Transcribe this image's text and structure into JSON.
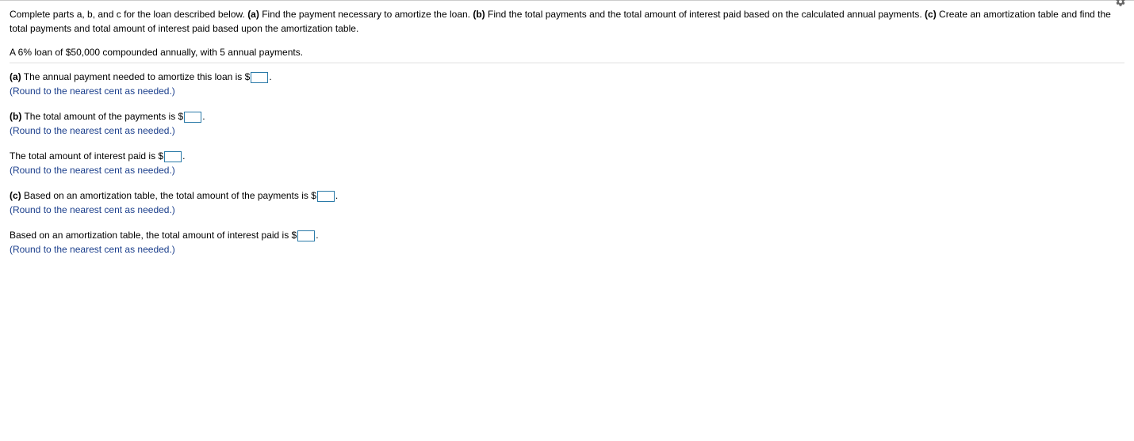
{
  "intro": {
    "prefix": "Complete parts a, b, and c for the loan described below. ",
    "a_label": "(a)",
    "a_text": " Find the payment necessary to amortize the loan. ",
    "b_label": "(b)",
    "b_text": " Find the total payments and the total amount of interest paid based on the calculated annual payments. ",
    "c_label": "(c)",
    "c_text": " Create an amortization table and find the total payments and total amount of interest paid based upon the amortization table."
  },
  "loan_description": "A 6% loan of $50,000 compounded annually, with 5 annual payments.",
  "parts": {
    "a": {
      "label": "(a)",
      "text_before": " The annual payment needed to amortize this loan is $",
      "text_after": ".",
      "hint": "(Round to the nearest cent as needed.)"
    },
    "b1": {
      "label": "(b)",
      "text_before": " The total amount of the payments is $",
      "text_after": ".",
      "hint": "(Round to the nearest cent as needed.)"
    },
    "b2": {
      "text_before": "The total amount of interest paid is $",
      "text_after": ".",
      "hint": "(Round to the nearest cent as needed.)"
    },
    "c1": {
      "label": "(c)",
      "text_before": " Based on an amortization table, the total amount of the payments is $",
      "text_after": ".",
      "hint": "(Round to the nearest cent as needed.)"
    },
    "c2": {
      "text_before": "Based on an amortization table, the total amount of interest paid is $",
      "text_after": ".",
      "hint": "(Round to the nearest cent as needed.)"
    }
  }
}
